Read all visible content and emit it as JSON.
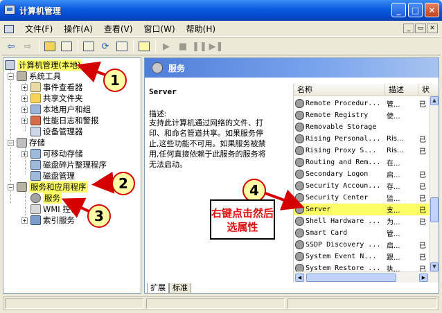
{
  "window": {
    "title": "计算机管理",
    "controls": {
      "minimize": "_",
      "maximize": "□",
      "close": "✕"
    }
  },
  "menubar": {
    "items": [
      "文件(F)",
      "操作(A)",
      "查看(V)",
      "窗口(W)",
      "帮助(H)"
    ],
    "mdi_controls": [
      "_",
      "▭",
      "✕"
    ]
  },
  "toolbar": {
    "buttons": [
      "back-icon",
      "forward-icon",
      "up-folder-icon",
      "show-tree-icon",
      "properties-icon",
      "refresh-icon",
      "export-icon",
      "help-icon",
      "play-icon",
      "stop-icon",
      "pause-icon",
      "restart-icon"
    ]
  },
  "tree": {
    "root": "计算机管理(本地)",
    "system_tools": "系统工具",
    "event_viewer": "事件查看器",
    "shared_folders": "共享文件夹",
    "local_users": "本地用户和组",
    "perf_logs": "性能日志和警报",
    "device_manager": "设备管理器",
    "storage": "存储",
    "removable_storage": "可移动存储",
    "defrag": "磁盘碎片整理程序",
    "disk_mgmt": "磁盘管理",
    "services_apps": "服务和应用程序",
    "services": "服务",
    "wmi": "WMI 控件",
    "index_service": "索引服务"
  },
  "right_pane": {
    "header_title": "服务",
    "selected_service_name": "Server",
    "description_label": "描述:",
    "description_lines": [
      "支持此计算机通过网络的文件、打",
      "印、和命名管道共享。如果服务停",
      "止,这些功能不可用。如果服务被禁",
      "用,任何直接依赖于此服务的服务将",
      "无法启动。"
    ],
    "columns": [
      "名称",
      "描述",
      "状"
    ],
    "services": [
      {
        "name": "Remote Procedur...",
        "desc": "管...",
        "state": "已"
      },
      {
        "name": "Remote Registry",
        "desc": "使...",
        "state": ""
      },
      {
        "name": "Removable Storage",
        "desc": "",
        "state": ""
      },
      {
        "name": "Rising Personal...",
        "desc": "Ris...",
        "state": "已"
      },
      {
        "name": "Rising Proxy  S...",
        "desc": "Ris...",
        "state": "已"
      },
      {
        "name": "Routing and Rem...",
        "desc": "在...",
        "state": ""
      },
      {
        "name": "Secondary Logon",
        "desc": "启...",
        "state": "已"
      },
      {
        "name": "Security Accoun...",
        "desc": "存...",
        "state": "已"
      },
      {
        "name": "Security Center",
        "desc": "监...",
        "state": "已"
      },
      {
        "name": "Server",
        "desc": "支...",
        "state": "已"
      },
      {
        "name": "Shell Hardware ...",
        "desc": "为...",
        "state": "已"
      },
      {
        "name": "Smart Card",
        "desc": "管...",
        "state": ""
      },
      {
        "name": "SSDP Discovery ...",
        "desc": "启...",
        "state": "已"
      },
      {
        "name": "System Event N...",
        "desc": "跟...",
        "state": "已"
      },
      {
        "name": "System Restore ...",
        "desc": "执...",
        "state": "已"
      }
    ],
    "selected_index": 9,
    "tabs": [
      "扩展",
      "标准"
    ]
  },
  "annotations": {
    "callouts": [
      "1",
      "2",
      "3",
      "4"
    ],
    "note": "右键点击然后选属性",
    "color": "#d40000",
    "note_color": "#e01010",
    "highlight_color": "#ffff66"
  }
}
